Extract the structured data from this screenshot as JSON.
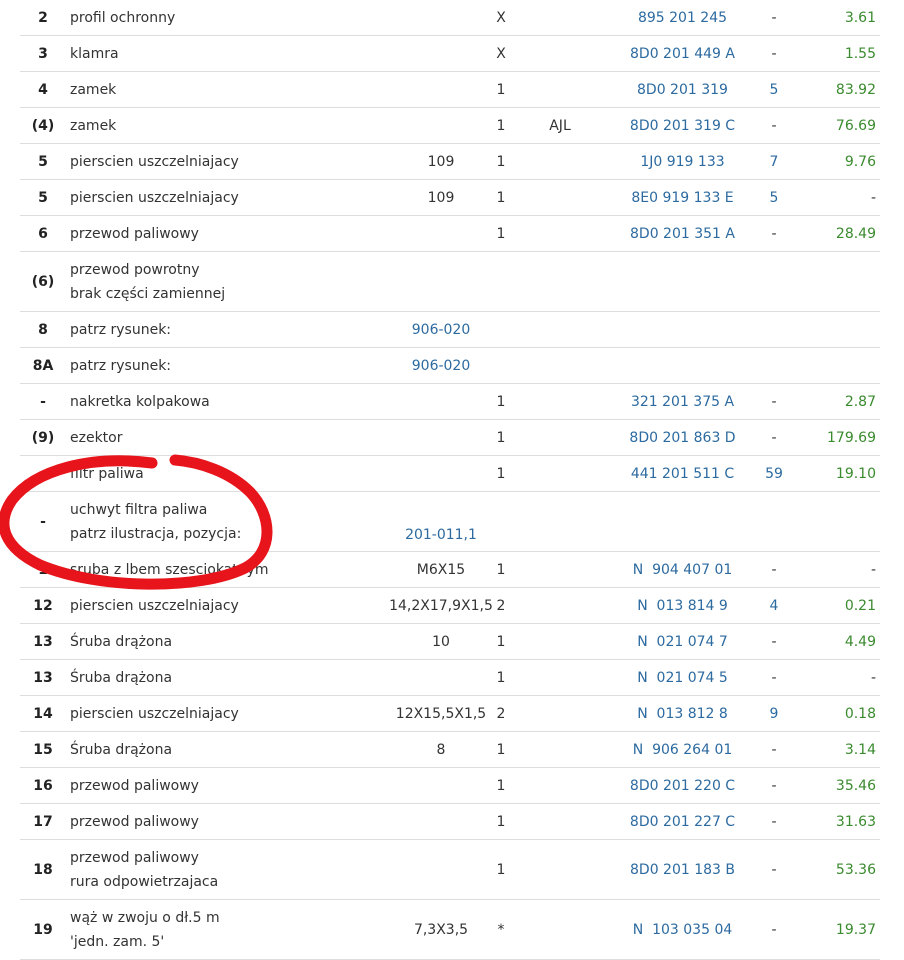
{
  "rows": [
    {
      "pos": "2",
      "lines": [
        "profil ochronny"
      ],
      "remark": "",
      "qty": "X",
      "model": "",
      "part": "895 201 245",
      "stock": "-",
      "price": "3.61"
    },
    {
      "pos": "3",
      "lines": [
        "klamra"
      ],
      "remark": "",
      "qty": "X",
      "model": "",
      "part": "8D0 201 449 A",
      "stock": "-",
      "price": "1.55"
    },
    {
      "pos": "4",
      "lines": [
        "zamek"
      ],
      "remark": "",
      "qty": "1",
      "model": "",
      "part": "8D0 201 319",
      "stock": "5",
      "price": "83.92"
    },
    {
      "pos": "(4)",
      "lines": [
        "zamek"
      ],
      "remark": "",
      "qty": "1",
      "model": "AJL",
      "part": "8D0 201 319 C",
      "stock": "-",
      "price": "76.69"
    },
    {
      "pos": "5",
      "lines": [
        "pierscien uszczelniajacy"
      ],
      "remark": "109",
      "qty": "1",
      "model": "",
      "part": "1J0 919 133",
      "stock": "7",
      "price": "9.76"
    },
    {
      "pos": "5",
      "lines": [
        "pierscien uszczelniajacy"
      ],
      "remark": "109",
      "qty": "1",
      "model": "",
      "part": "8E0 919 133 E",
      "stock": "5",
      "price": "-"
    },
    {
      "pos": "6",
      "lines": [
        "przewod paliwowy"
      ],
      "remark": "",
      "qty": "1",
      "model": "",
      "part": "8D0 201 351 A",
      "stock": "-",
      "price": "28.49"
    },
    {
      "pos": "(6)",
      "lines": [
        "przewod powrotny",
        "brak części zamiennej"
      ],
      "remark": "",
      "qty": "",
      "model": "",
      "part": "",
      "stock": "",
      "price": ""
    },
    {
      "pos": "8",
      "lines": [
        "patrz rysunek:"
      ],
      "remark": "906-020",
      "remark_link": true,
      "qty": "",
      "model": "",
      "part": "",
      "stock": "",
      "price": ""
    },
    {
      "pos": "8A",
      "lines": [
        "patrz rysunek:"
      ],
      "remark": "906-020",
      "remark_link": true,
      "qty": "",
      "model": "",
      "part": "",
      "stock": "",
      "price": ""
    },
    {
      "pos": "-",
      "lines": [
        "nakretka kolpakowa"
      ],
      "remark": "",
      "qty": "1",
      "model": "",
      "part": "321 201 375 A",
      "stock": "-",
      "price": "2.87"
    },
    {
      "pos": "(9)",
      "lines": [
        "ezektor"
      ],
      "remark": "",
      "qty": "1",
      "model": "",
      "part": "8D0 201 863 D",
      "stock": "-",
      "price": "179.69"
    },
    {
      "pos": "",
      "lines": [
        "filtr paliwa"
      ],
      "remark": "",
      "qty": "1",
      "model": "",
      "part": "441 201 511 C",
      "stock": "59",
      "price": "19.10"
    },
    {
      "pos": "-",
      "lines": [
        "uchwyt filtra paliwa",
        "patrz ilustracja, pozycja:"
      ],
      "remark": "201-011,1",
      "remark_link": true,
      "remark_align": "bottom",
      "qty": "",
      "model": "",
      "part": "",
      "stock": "",
      "price": ""
    },
    {
      "pos": "1",
      "lines": [
        "sruba z lbem szesciokatnym"
      ],
      "remark": "M6X15",
      "qty": "1",
      "model": "",
      "part": "N  904 407 01",
      "stock": "-",
      "price": "-"
    },
    {
      "pos": "12",
      "lines": [
        "pierscien uszczelniajacy"
      ],
      "remark": "14,2X17,9X1,5",
      "qty": "2",
      "model": "",
      "part": "N  013 814 9",
      "stock": "4",
      "price": "0.21"
    },
    {
      "pos": "13",
      "lines": [
        "Śruba drążona"
      ],
      "remark": "10",
      "qty": "1",
      "model": "",
      "part": "N  021 074 7",
      "stock": "-",
      "price": "4.49"
    },
    {
      "pos": "13",
      "lines": [
        "Śruba drążona"
      ],
      "remark": "",
      "qty": "1",
      "model": "",
      "part": "N  021 074 5",
      "stock": "-",
      "price": "-"
    },
    {
      "pos": "14",
      "lines": [
        "pierscien uszczelniajacy"
      ],
      "remark": "12X15,5X1,5",
      "qty": "2",
      "model": "",
      "part": "N  013 812 8",
      "stock": "9",
      "price": "0.18"
    },
    {
      "pos": "15",
      "lines": [
        "Śruba drążona"
      ],
      "remark": "8",
      "qty": "1",
      "model": "",
      "part": "N  906 264 01",
      "stock": "-",
      "price": "3.14"
    },
    {
      "pos": "16",
      "lines": [
        "przewod paliwowy"
      ],
      "remark": "",
      "qty": "1",
      "model": "",
      "part": "8D0 201 220 C",
      "stock": "-",
      "price": "35.46"
    },
    {
      "pos": "17",
      "lines": [
        "przewod paliwowy"
      ],
      "remark": "",
      "qty": "1",
      "model": "",
      "part": "8D0 201 227 C",
      "stock": "-",
      "price": "31.63"
    },
    {
      "pos": "18",
      "lines": [
        "przewod paliwowy",
        "rura odpowietrzajaca"
      ],
      "remark": "",
      "qty": "1",
      "model": "",
      "part": "8D0 201 183 B",
      "stock": "-",
      "price": "53.36"
    },
    {
      "pos": "19",
      "lines": [
        "wąż w zwoju o dł.5 m",
        "'jedn. zam. 5'"
      ],
      "remark": "7,3X3,5",
      "qty": "*",
      "model": "",
      "part": "N  103 035 04",
      "stock": "-",
      "price": "19.37"
    }
  ],
  "annotation": {
    "color": "#e8141b",
    "type": "freehand-circle"
  }
}
